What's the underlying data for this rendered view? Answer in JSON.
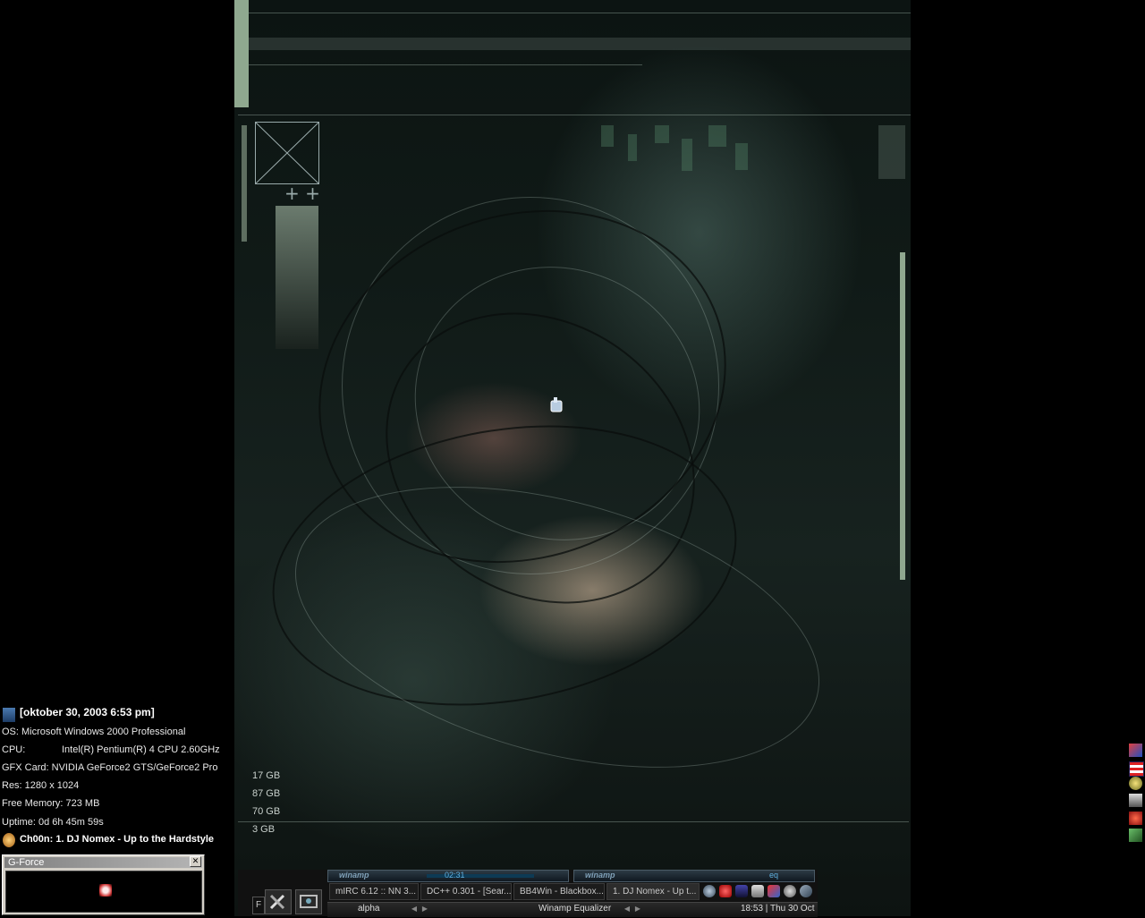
{
  "sysinfo": {
    "date": "[oktober 30, 2003   6:53 pm]",
    "os": "OS: Microsoft Windows 2000 Professional",
    "cpu_label": "CPU:",
    "cpu_value": "Intel(R) Pentium(R) 4 CPU 2.60GHz",
    "gfx": "GFX Card: NVIDIA GeForce2 GTS/GeForce2 Pro",
    "res": "Res: 1280 x 1024",
    "memory": "Free Memory: 723 MB",
    "uptime": "Uptime: 0d 6h 45m 59s",
    "now_playing": "Ch00n: 1. DJ Nomex - Up to the Hardstyle"
  },
  "gforce": {
    "title": "G-Force",
    "close": "✕"
  },
  "disks": [
    "17 GB",
    "87 GB",
    "70 GB",
    "3 GB"
  ],
  "winamp": {
    "main_label": "winamp",
    "time": "02:31",
    "eq_label": "winamp",
    "eq_tag": "eq"
  },
  "taskbar": {
    "start": "F",
    "tasks": [
      "mIRC 6.12 :: NN 3...",
      "DC++ 0.301 - [Sear...",
      "BB4Win - Blackbox...",
      "1. DJ Nomex - Up t..."
    ],
    "workspace": "alpha",
    "focused_window": "Winamp Equalizer",
    "clock": "18:53 | Thu 30 Oct"
  },
  "icons": {
    "tray": [
      "mirc-tray-icon",
      "flag-tray-icon",
      "winamp-tray-icon",
      "network-tray-icon",
      "firewall-tray-icon",
      "dc-tray-icon"
    ],
    "quicklaunch": [
      "globe-icon",
      "gear-icon",
      "monitor-icon",
      "window-icon",
      "app-icon",
      "search-icon",
      "link-icon"
    ]
  }
}
